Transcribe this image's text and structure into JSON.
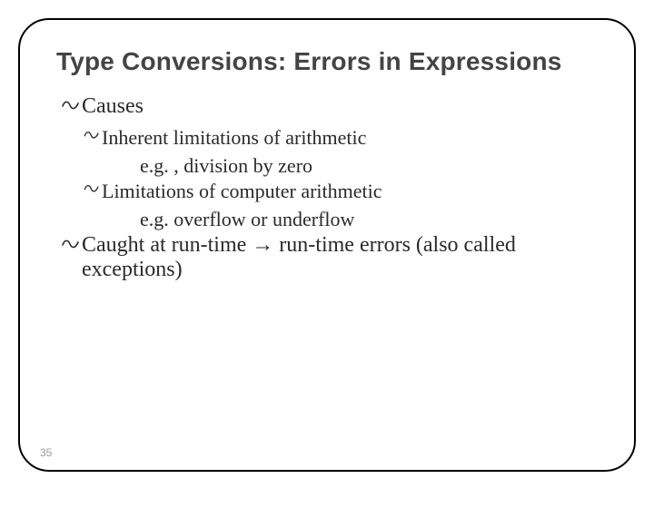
{
  "title": "Type Conversions: Errors in Expressions",
  "bullets": {
    "causes": "Causes",
    "inherent": "Inherent limitations of arithmetic",
    "inherent_eg": "e.g. , division by zero",
    "computer": "Limitations of computer arithmetic",
    "computer_eg": "e.g. overflow or underflow",
    "caught_pre": " Caught at run-time ",
    "caught_post": " run-time errors (also called exceptions)"
  },
  "arrow": "→",
  "page_number": "35"
}
